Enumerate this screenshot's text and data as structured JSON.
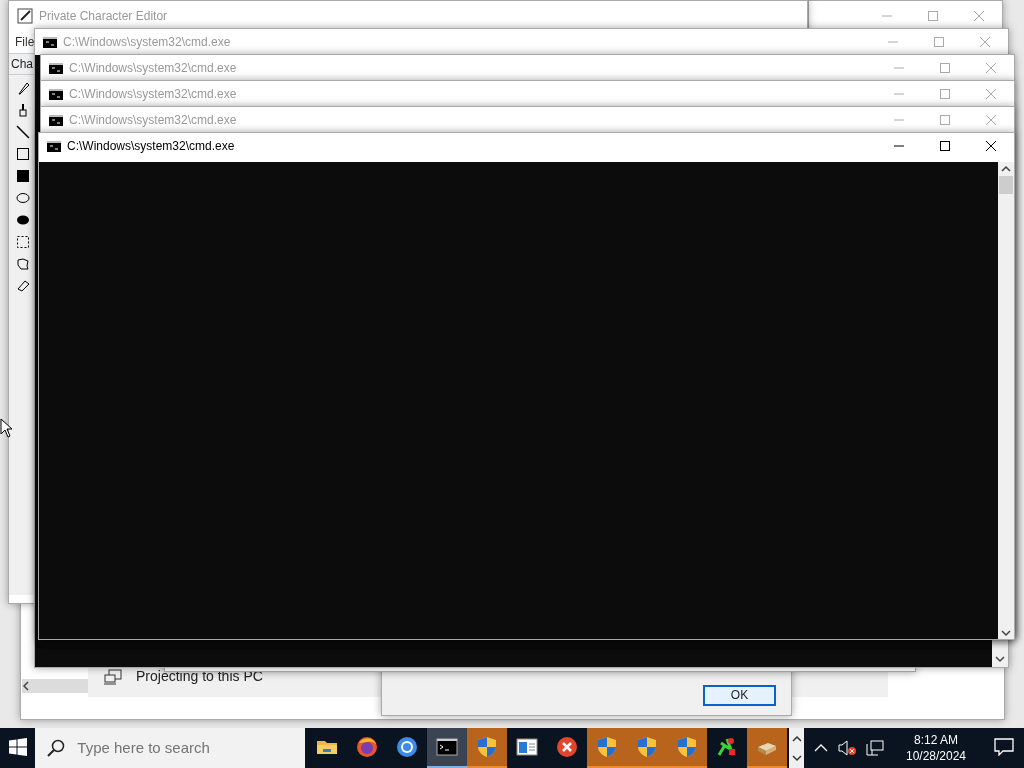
{
  "editor_window": {
    "title": "Private Character Editor",
    "menu": [
      "File"
    ],
    "tab": "Cha"
  },
  "settings_window": {
    "item": "Projecting to this PC"
  },
  "dialog": {
    "button": "OK"
  },
  "cmd_windows": [
    {
      "title": "C:\\Windows\\system32\\cmd.exe",
      "active": false
    },
    {
      "title": "C:\\Windows\\system32\\cmd.exe",
      "active": false
    },
    {
      "title": "C:\\Windows\\system32\\cmd.exe",
      "active": false
    },
    {
      "title": "C:\\Windows\\system32\\cmd.exe",
      "active": false
    },
    {
      "title": "C:\\Windows\\system32\\cmd.exe",
      "active": true
    }
  ],
  "taskbar": {
    "search": {
      "placeholder": "Type here to search"
    },
    "apps": [
      {
        "kind": "folder",
        "selected": false,
        "flashing": false
      },
      {
        "kind": "firefox",
        "selected": false,
        "flashing": false
      },
      {
        "kind": "chrome",
        "selected": false,
        "flashing": false
      },
      {
        "kind": "terminal",
        "selected": true,
        "flashing": false
      },
      {
        "kind": "shield",
        "selected": false,
        "flashing": true
      },
      {
        "kind": "window",
        "selected": false,
        "flashing": false
      },
      {
        "kind": "error",
        "selected": false,
        "flashing": false
      },
      {
        "kind": "shield",
        "selected": false,
        "flashing": true
      },
      {
        "kind": "shield",
        "selected": false,
        "flashing": true
      },
      {
        "kind": "shield",
        "selected": false,
        "flashing": true
      },
      {
        "kind": "tools",
        "selected": false,
        "flashing": false
      },
      {
        "kind": "box",
        "selected": false,
        "flashing": true
      }
    ],
    "time": "8:12 AM",
    "date": "10/28/2024"
  }
}
